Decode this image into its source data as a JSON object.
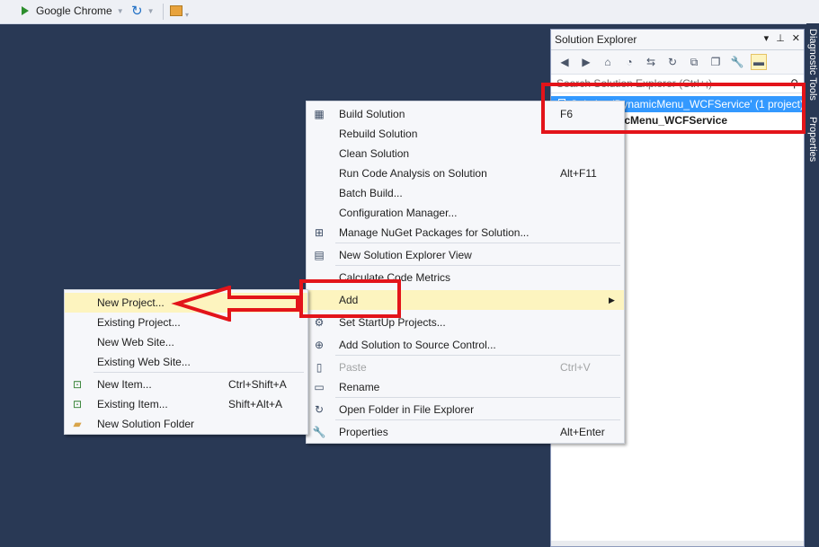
{
  "toolbar": {
    "browser_label": "Google Chrome"
  },
  "solution_explorer": {
    "title": "Solution Explorer",
    "search_placeholder": "Search Solution Explorer (Ctrl+;)",
    "tree": [
      {
        "label": "Solution 'DynamicMenu_WCFService' (1 project)",
        "selected": true
      },
      {
        "label": "DynamicMenu_WCFService",
        "bold": true
      }
    ]
  },
  "right_tabs": [
    "Diagnostic Tools",
    "Properties"
  ],
  "context_menu": {
    "items": [
      {
        "label": "Build Solution",
        "shortcut": "F6",
        "icon": "build-icon"
      },
      {
        "label": "Rebuild Solution",
        "shortcut": ""
      },
      {
        "label": "Clean Solution",
        "shortcut": ""
      },
      {
        "label": "Run Code Analysis on Solution",
        "shortcut": "Alt+F11"
      },
      {
        "label": "Batch Build...",
        "shortcut": ""
      },
      {
        "label": "Configuration Manager...",
        "shortcut": ""
      },
      {
        "label": "Manage NuGet Packages for Solution...",
        "shortcut": "",
        "icon": "nuget-icon"
      },
      {
        "label": "New Solution Explorer View",
        "shortcut": "",
        "icon": "new-view-icon"
      },
      {
        "label": "Calculate Code Metrics",
        "shortcut": ""
      },
      {
        "label": "Add",
        "shortcut": "",
        "submenu": true,
        "highlighted": true
      },
      {
        "label": "Set StartUp Projects...",
        "shortcut": "",
        "icon": "gear-icon"
      },
      {
        "label": "Add Solution to Source Control...",
        "shortcut": "",
        "icon": "source-control-icon"
      },
      {
        "label": "Paste",
        "shortcut": "Ctrl+V",
        "icon": "paste-icon",
        "disabled": true
      },
      {
        "label": "Rename",
        "shortcut": "",
        "icon": "rename-icon"
      },
      {
        "label": "Open Folder in File Explorer",
        "shortcut": "",
        "icon": "refresh-folder-icon"
      },
      {
        "label": "Properties",
        "shortcut": "Alt+Enter",
        "icon": "wrench-icon"
      }
    ]
  },
  "add_submenu": {
    "items": [
      {
        "label": "New Project...",
        "shortcut": "",
        "highlighted": true
      },
      {
        "label": "Existing Project...",
        "shortcut": ""
      },
      {
        "label": "New Web Site...",
        "shortcut": ""
      },
      {
        "label": "Existing Web Site...",
        "shortcut": ""
      },
      {
        "label": "New Item...",
        "shortcut": "Ctrl+Shift+A",
        "icon": "new-item-icon"
      },
      {
        "label": "Existing Item...",
        "shortcut": "Shift+Alt+A",
        "icon": "existing-item-icon"
      },
      {
        "label": "New Solution Folder",
        "shortcut": "",
        "icon": "folder-icon"
      }
    ]
  },
  "colors": {
    "background": "#293955",
    "highlight": "#fdf4bf",
    "annotation_red": "#e3141a",
    "selection_blue": "#3399ff"
  }
}
